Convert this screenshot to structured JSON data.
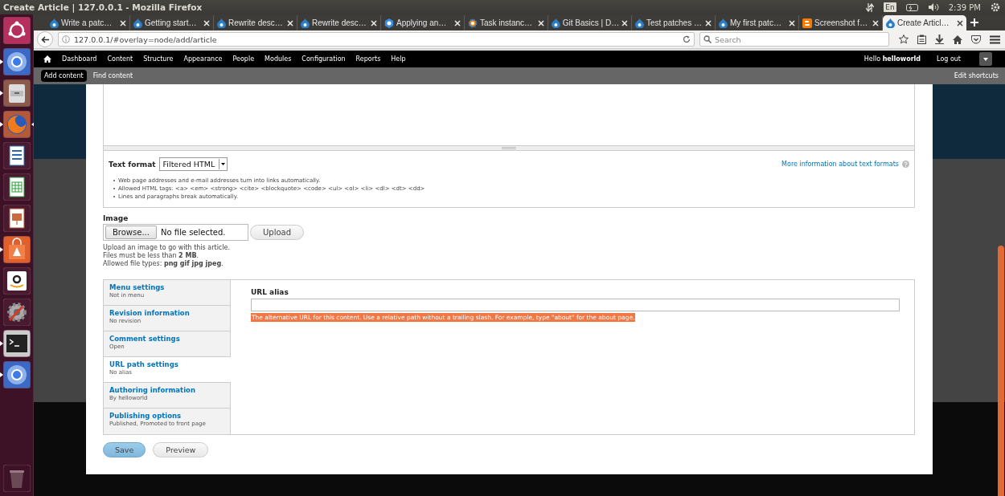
{
  "system_panel": {
    "title": "Create Article | 127.0.0.1 - Mozilla Firefox",
    "keyboard": "En",
    "clock": "2:39 PM"
  },
  "launcher": {
    "items": [
      {
        "kind": "ubuntu",
        "running": false,
        "focused": false
      },
      {
        "kind": "chromium",
        "running": true,
        "focused": false
      },
      {
        "kind": "files",
        "running": true,
        "focused": false
      },
      {
        "kind": "firefox",
        "running": true,
        "focused": true
      },
      {
        "kind": "writer",
        "running": false,
        "focused": false
      },
      {
        "kind": "calc",
        "running": false,
        "focused": false
      },
      {
        "kind": "impress",
        "running": false,
        "focused": false
      },
      {
        "kind": "software",
        "running": true,
        "focused": false
      },
      {
        "kind": "amazon",
        "running": false,
        "focused": false
      },
      {
        "kind": "settings",
        "running": false,
        "focused": false
      },
      {
        "kind": "terminal",
        "running": true,
        "focused": false
      },
      {
        "kind": "chromium",
        "running": true,
        "focused": false
      },
      {
        "kind": "trash",
        "running": false,
        "focused": false
      }
    ]
  },
  "tabs": [
    {
      "label": "Write a patc…",
      "kind": "drupal",
      "selected": false
    },
    {
      "label": "Getting start…",
      "kind": "drupal",
      "selected": false
    },
    {
      "label": "Rewrite desc…",
      "kind": "drupal",
      "selected": false
    },
    {
      "label": "Rewrite desc…",
      "kind": "drupal",
      "selected": false
    },
    {
      "label": "Applying an…",
      "kind": "hexagon",
      "selected": false
    },
    {
      "label": "Task instanc…",
      "kind": "gear",
      "selected": false
    },
    {
      "label": "Git Basics | D…",
      "kind": "drupal",
      "selected": false
    },
    {
      "label": "Test patches …",
      "kind": "drupal",
      "selected": false
    },
    {
      "label": "My first patc…",
      "kind": "drupal",
      "selected": false
    },
    {
      "label": "Screenshot f…",
      "kind": "blog",
      "selected": false
    },
    {
      "label": "Create Articl…",
      "kind": "drupal",
      "selected": true
    }
  ],
  "address_bar": {
    "url": "127.0.0.1/#overlay=node/add/article"
  },
  "search": {
    "placeholder": "Search"
  },
  "toolbar": {
    "menu": [
      "Dashboard",
      "Content",
      "Structure",
      "Appearance",
      "People",
      "Modules",
      "Configuration",
      "Reports",
      "Help"
    ],
    "greeting": "Hello **helloworld**",
    "logout": "Log out"
  },
  "shortcuts": {
    "items": [
      {
        "label": "Add content",
        "selected": true
      },
      {
        "label": "Find content",
        "selected": false
      }
    ],
    "edit": "Edit shortcuts"
  },
  "text_format": {
    "label": "Text format",
    "select": "Filtered HTML",
    "link": "More information about text formats",
    "tips": [
      "Web page addresses and e-mail addresses turn into links automatically.",
      "Allowed HTML tags: <a> <em> <strong> <cite> <blockquote> <code> <ul> <ol> <li> <dl> <dt> <dd>",
      "Lines and paragraphs break automatically."
    ]
  },
  "image": {
    "label": "Image",
    "browse": "Browse...",
    "file_status": "No file selected.",
    "upload": "Upload",
    "description": [
      "Upload an image to go with this article.",
      "Files must be less than **2 MB**.",
      "Allowed file types: **png gif jpg jpeg**."
    ]
  },
  "vertical_tabs": [
    {
      "title": "Menu settings",
      "summary": "Not in menu",
      "selected": false
    },
    {
      "title": "Revision information",
      "summary": "No revision",
      "selected": false
    },
    {
      "title": "Comment settings",
      "summary": "Open",
      "selected": false
    },
    {
      "title": "URL path settings",
      "summary": "No alias",
      "selected": true
    },
    {
      "title": "Authoring information",
      "summary": "By helloworld",
      "selected": false
    },
    {
      "title": "Publishing options",
      "summary": "Published, Promoted to front page",
      "selected": false
    }
  ],
  "url_alias": {
    "label": "URL alias",
    "description": "The alternative URL for this content. Use a relative path without a trailing slash. For example, type \"about\" for the about page.",
    "highlighted": true
  },
  "actions": [
    {
      "label": "Save",
      "kind": "primary"
    },
    {
      "label": "Preview",
      "kind": "secondary"
    }
  ]
}
